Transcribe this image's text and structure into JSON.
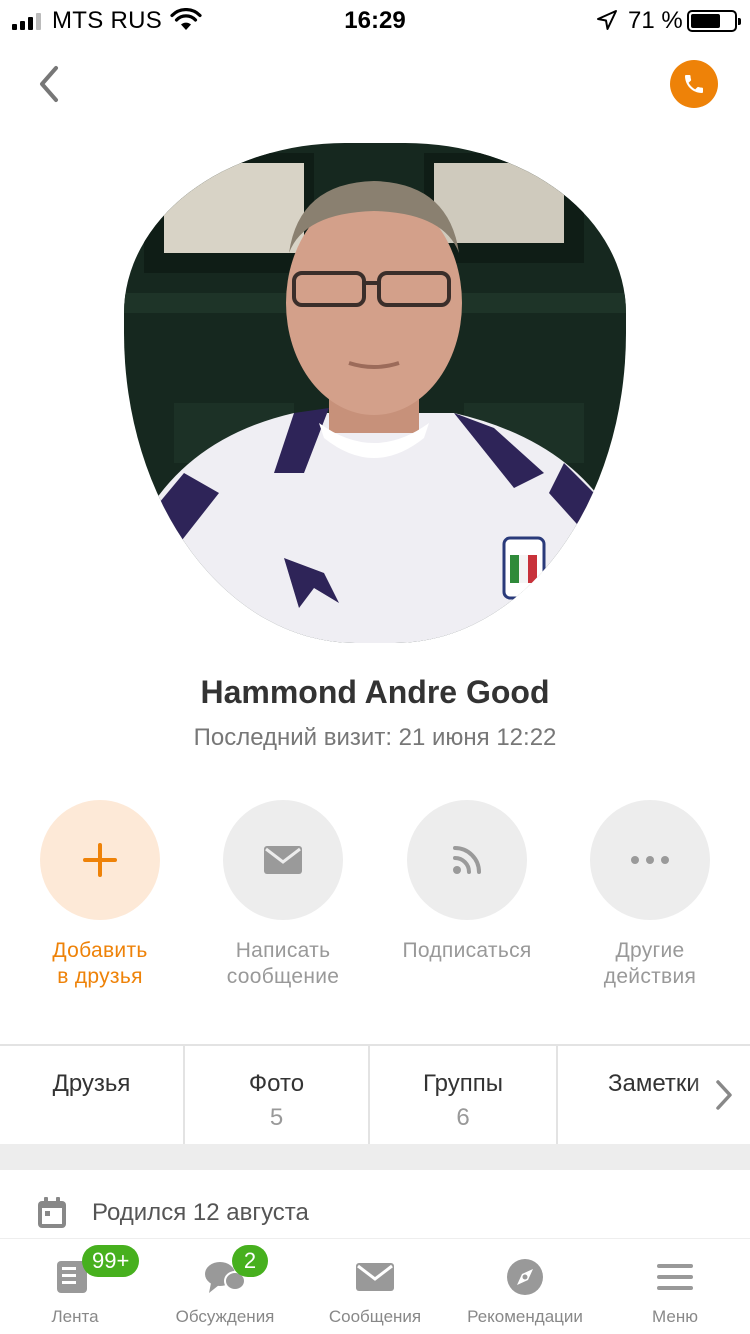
{
  "status_bar": {
    "carrier": "MTS RUS",
    "time": "16:29",
    "battery_percent": "71 %",
    "battery_level": 0.71,
    "icons": [
      "signal-icon",
      "wifi-icon",
      "location-arrow-icon",
      "battery-icon"
    ]
  },
  "header": {
    "back_icon": "chevron-left-icon",
    "call_icon": "phone-icon"
  },
  "colors": {
    "accent": "#ee8208",
    "accent_light": "#fde9d7",
    "badge_green": "#47b01e",
    "muted": "#999999"
  },
  "profile": {
    "name": "Hammond Andre Good",
    "last_visit": "Последний визит: 21 июня 12:22"
  },
  "actions": [
    {
      "line1": "Добавить",
      "line2": "в друзья",
      "icon": "plus-icon"
    },
    {
      "line1": "Написать",
      "line2": "сообщение",
      "icon": "envelope-icon"
    },
    {
      "line1": "Подписаться",
      "line2": "",
      "icon": "rss-icon"
    },
    {
      "line1": "Другие",
      "line2": "действия",
      "icon": "more-dots-icon"
    }
  ],
  "tabs": [
    {
      "label": "Друзья",
      "count": ""
    },
    {
      "label": "Фото",
      "count": "5"
    },
    {
      "label": "Группы",
      "count": "6"
    },
    {
      "label": "Заметки",
      "count": ""
    }
  ],
  "info": {
    "birthday": "Родился 12 августа",
    "icon": "calendar-icon"
  },
  "bottom_nav": [
    {
      "label": "Лента",
      "icon": "feed-icon",
      "badge": "99+"
    },
    {
      "label": "Обсуждения",
      "icon": "chat-bubbles-icon",
      "badge": "2"
    },
    {
      "label": "Сообщения",
      "icon": "envelope-icon",
      "badge": ""
    },
    {
      "label": "Рекомендации",
      "icon": "compass-icon",
      "badge": ""
    },
    {
      "label": "Меню",
      "icon": "hamburger-menu-icon",
      "badge": ""
    }
  ]
}
